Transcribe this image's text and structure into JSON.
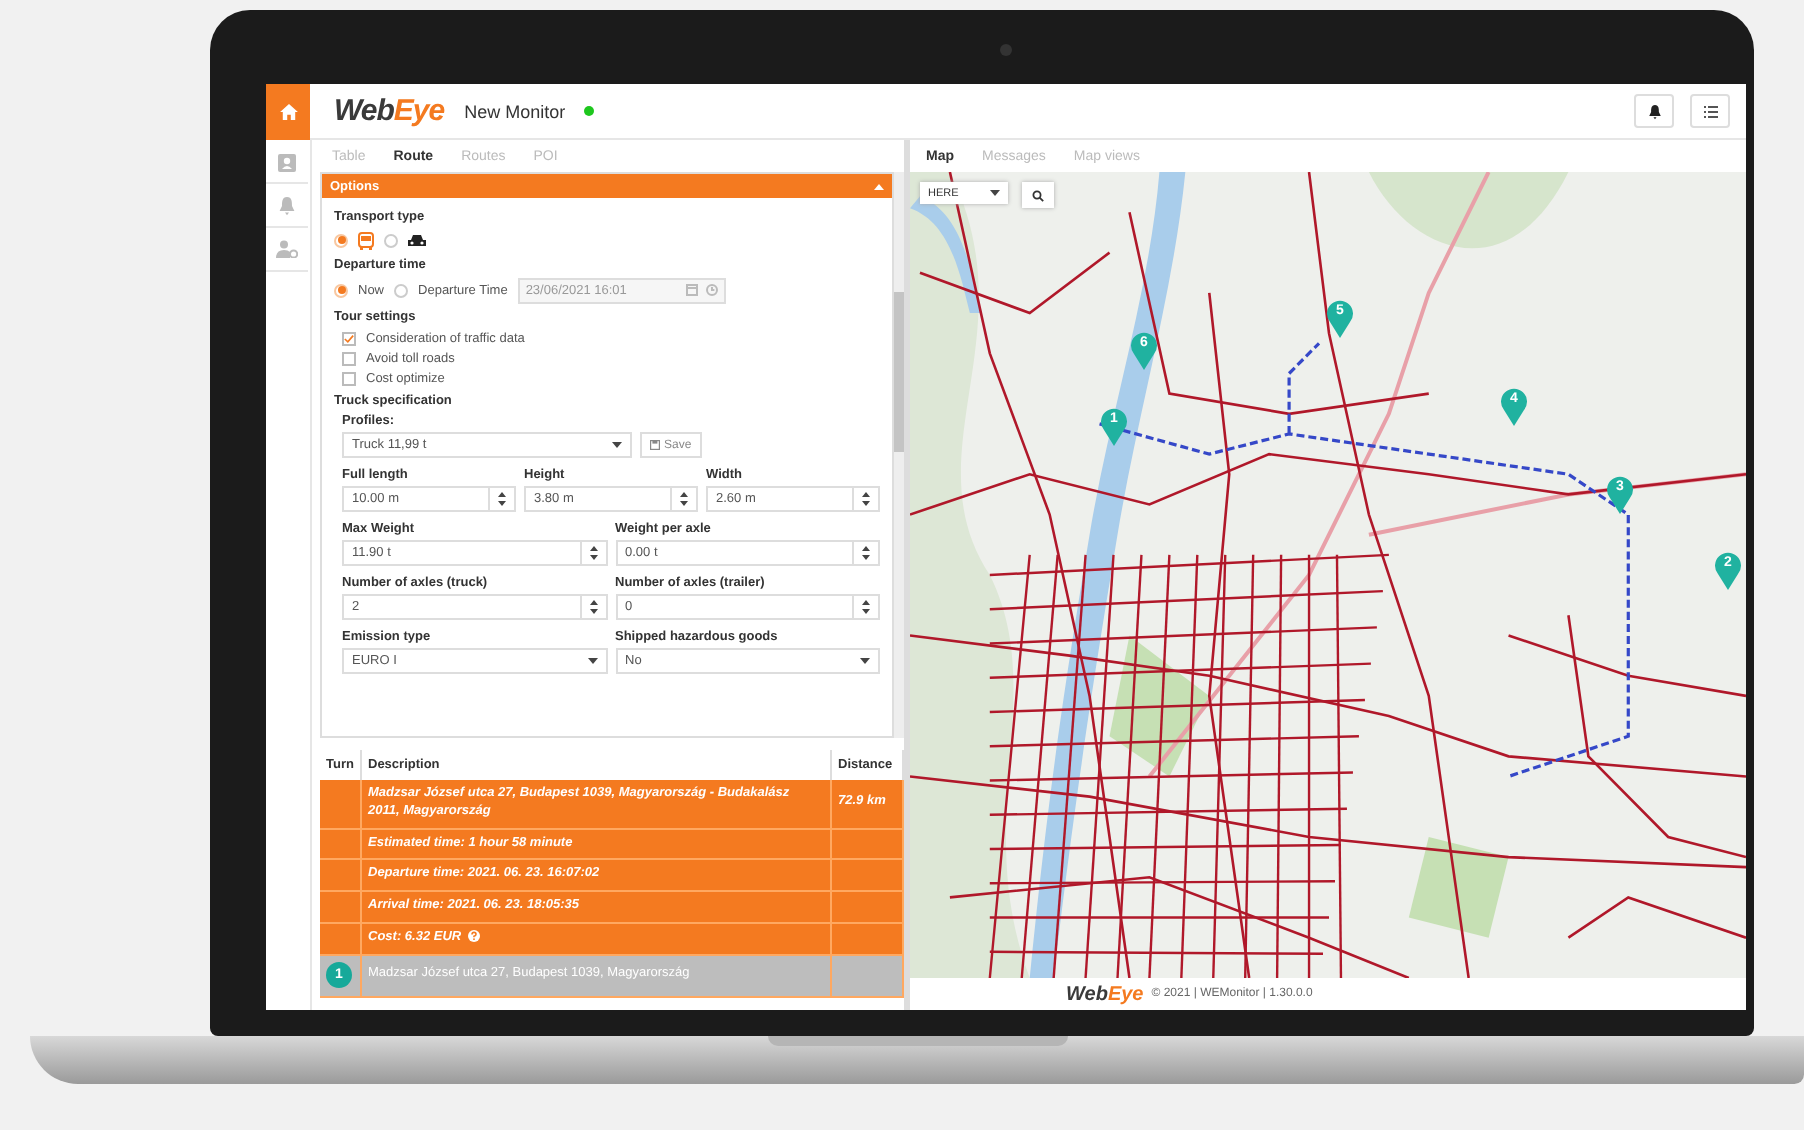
{
  "header": {
    "logo": {
      "part1": "Web",
      "part2": "Eye"
    },
    "title": "New Monitor",
    "connected": true
  },
  "sidebar": {
    "items": [
      {
        "kind": "home",
        "selected": true
      },
      {
        "kind": "contact",
        "selected": false
      },
      {
        "kind": "alarm",
        "selected": false
      },
      {
        "kind": "user-settings",
        "selected": false
      }
    ]
  },
  "left_tabs": [
    {
      "label": "Table",
      "selected": false
    },
    {
      "label": "Route",
      "selected": true
    },
    {
      "label": "Routes",
      "selected": false
    },
    {
      "label": "POI",
      "selected": false
    }
  ],
  "options": {
    "title": "Options",
    "expanded": true
  },
  "transport_type": {
    "label": "Transport type",
    "options": [
      {
        "kind": "bus",
        "selected": true
      },
      {
        "kind": "car",
        "selected": false
      }
    ]
  },
  "departure_time": {
    "label": "Departure time",
    "options": [
      {
        "label": "Now",
        "selected": true
      },
      {
        "label": "Departure Time",
        "selected": false
      }
    ],
    "field": {
      "value": "23/06/2021 16:01",
      "disabled": true
    }
  },
  "tour_settings": {
    "label": "Tour settings",
    "items": [
      {
        "label": "Consideration of traffic data",
        "checked": true
      },
      {
        "label": "Avoid toll roads",
        "checked": false
      },
      {
        "label": "Cost optimize",
        "checked": false
      }
    ]
  },
  "truck_specification": {
    "label": "Truck specification",
    "profiles_label": "Profiles:",
    "profile_value": "Truck 11,99 t",
    "save_button": "Save",
    "rows": [
      [
        {
          "label": "Full length",
          "value": "10.00 m",
          "kind": "number"
        },
        {
          "label": "Height",
          "value": "3.80 m",
          "kind": "number"
        },
        {
          "label": "Width",
          "value": "2.60 m",
          "kind": "number"
        }
      ],
      [
        {
          "label": "Max Weight",
          "value": "11.90 t",
          "kind": "number"
        },
        {
          "label": "Weight per axle",
          "value": "0.00 t",
          "kind": "number"
        }
      ],
      [
        {
          "label": "Number of axles (truck)",
          "value": "2",
          "kind": "number"
        },
        {
          "label": "Number of axles (trailer)",
          "value": "0",
          "kind": "number"
        }
      ],
      [
        {
          "label": "Emission type",
          "value": "EURO I",
          "kind": "select"
        },
        {
          "label": "Shipped hazardous goods",
          "value": "No",
          "kind": "select"
        }
      ]
    ]
  },
  "route_table": {
    "columns": [
      "Turn",
      "Description",
      "Distance"
    ],
    "rows": [
      {
        "kind": "summary",
        "description": "Madzsar József utca 27, Budapest 1039, Magyarország - Budakalász 2011, Magyarország",
        "distance": "72.9 km",
        "help": false
      },
      {
        "kind": "summary",
        "description": "Estimated time: 1 hour 58 minute",
        "help": false
      },
      {
        "kind": "summary",
        "description": "Departure time: 2021. 06. 23. 16:07:02",
        "help": false
      },
      {
        "kind": "summary",
        "description": "Arrival time: 2021. 06. 23. 18:05:35",
        "help": false
      },
      {
        "kind": "summary",
        "description": "Cost: 6.32 EUR",
        "help": true
      },
      {
        "kind": "step",
        "turn": "1",
        "description": "Madzsar József utca 27, Budapest 1039, Magyarország",
        "help": false
      }
    ]
  },
  "map": {
    "tabs": [
      {
        "label": "Map",
        "selected": true
      },
      {
        "label": "Messages",
        "selected": false
      },
      {
        "label": "Map views",
        "selected": false
      }
    ],
    "provider": "HERE",
    "markers": [
      {
        "label": "1"
      },
      {
        "label": "2"
      },
      {
        "label": "3"
      },
      {
        "label": "4"
      },
      {
        "label": "5"
      },
      {
        "label": "6"
      }
    ]
  },
  "footer": {
    "logo": {
      "part1": "Web",
      "part2": "Eye"
    },
    "text": "© 2021 | WEMonitor | 1.30.0.0"
  }
}
